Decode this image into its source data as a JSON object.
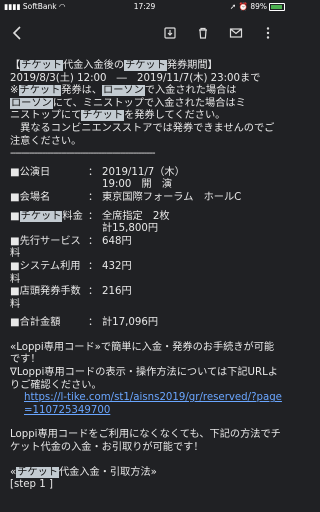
{
  "status": {
    "carrier": "SoftBank",
    "time": "17:29",
    "battery": "89%"
  },
  "toolbar": {},
  "email": {
    "l1_pre": "【",
    "l1_hl1": "チケット",
    "l1_mid": "代金入金後の",
    "l1_hl2": "チケット",
    "l1_post": "発券期間】",
    "l2": "2019/8/3(土) 12:00　―　2019/11/7(木) 23:00まで",
    "l3_a": "※",
    "l3_hl1": "チケット",
    "l3_b": "発券は、",
    "l3_hl2": "ローソン",
    "l3_c": "で入金された場合は",
    "l4_hl1": "ローソン",
    "l4_b": "にて、ミニストップで入金された場合はミ",
    "l5_a": "ニストップにて",
    "l5_hl1": "チケット",
    "l5_b": "を発券してください。",
    "l6": "　異なるコンビニエンスストアでは発券できませんのでご注意ください。",
    "rule": "------------------------------------------------------",
    "f_perf_k": "■公演日",
    "f_perf_v1": "2019/11/7（木）",
    "f_perf_v2": "19:00　開　演",
    "f_venue_k": "■会場名",
    "f_venue_v": "東京国際フォーラム　ホールC",
    "f_tk_pre": "■",
    "f_tk_hl": "チケット",
    "f_tk_post": "料金",
    "f_tk_v1": "全席指定　2枚",
    "f_tk_v2": "計15,800円",
    "f_pre_k": "■先行サービス料",
    "f_pre_v": "648円",
    "f_sys_k": "■システム利用料",
    "f_sys_v": "432円",
    "f_store_k": "■店頭発券手数料",
    "f_store_v": "216円",
    "f_total_k": "■合計金額",
    "f_total_v": "計17,096円",
    "colon": "：",
    "loppi1": "«Loppi専用コード»で簡単に入金・発券のお手続きが可能です！",
    "loppi2": "∇Loppi専用コードの表示・操作方法については下記URLよりご確認ください。",
    "url": "https://l-tike.com/st1/aisns2019/gr/reserved/?page=110725349700",
    "nocode": "Loppi専用コードをご利用になくなくても、下記の方法でチケット代金の入金・お引取りが可能です！",
    "sec_pre": "«",
    "sec_hl": "チケット",
    "sec_post": "代金入金・引取方法»",
    "step": "[step 1 ]"
  }
}
